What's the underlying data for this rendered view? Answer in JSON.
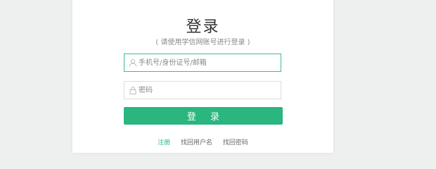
{
  "login": {
    "title": "登录",
    "subtitle": "( 请使用学信网账号进行登录 )",
    "username_placeholder": "手机号/身份证号/邮箱",
    "password_placeholder": "密码",
    "submit_label": "登 录",
    "links": {
      "register": "注册",
      "find_username": "找回用户名",
      "find_password": "找回密码"
    }
  },
  "colors": {
    "accent": "#2bb57f",
    "background": "#eef0f0",
    "card": "#ffffff"
  },
  "icons": {
    "username": "user-icon",
    "password": "lock-icon"
  }
}
